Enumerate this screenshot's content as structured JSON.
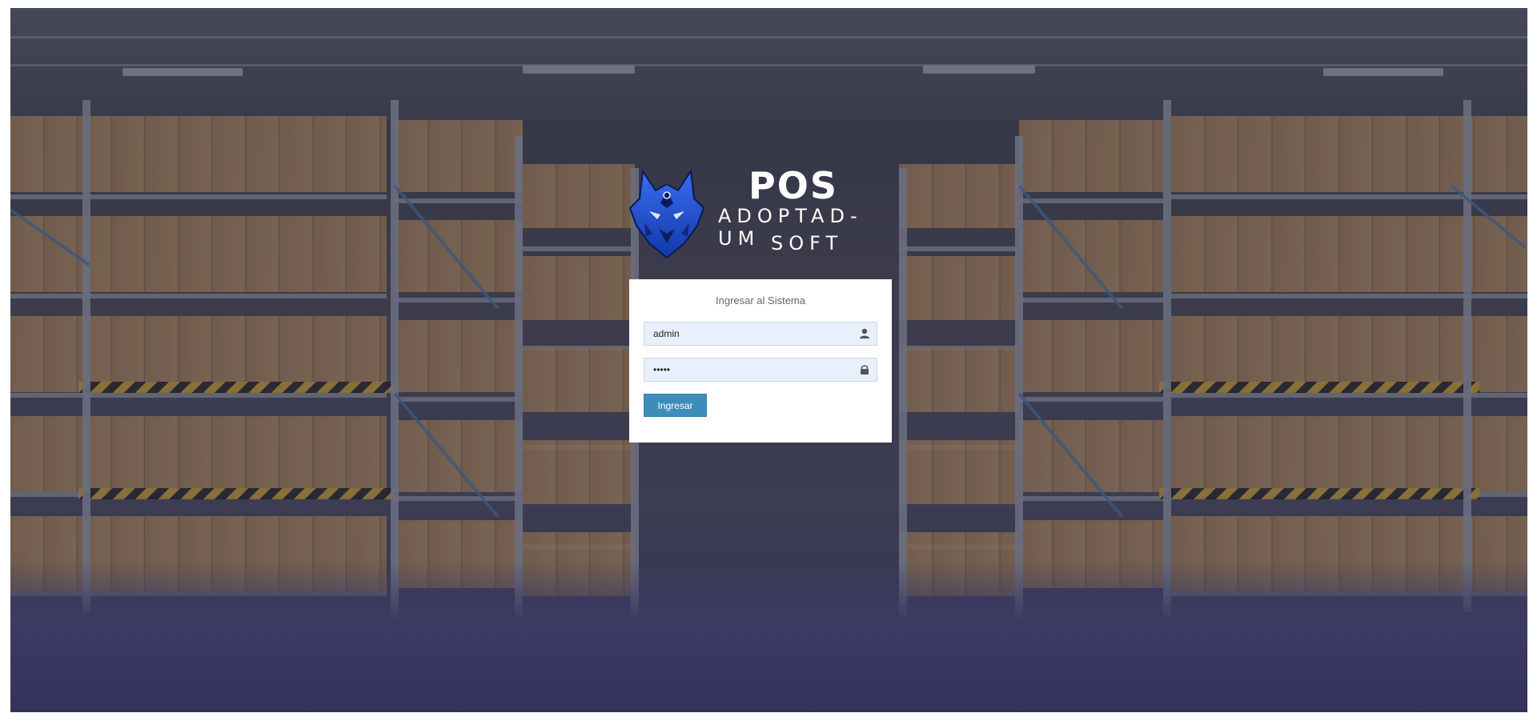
{
  "brand": {
    "title": "POS",
    "line1": "ADOPTAD-UM",
    "line2": "SOFT"
  },
  "login": {
    "heading": "Ingresar al Sistema",
    "username_value": "admin",
    "password_value": "•••••",
    "submit_label": "Ingresar"
  },
  "icons": {
    "username": "user-icon",
    "password": "lock-icon",
    "logo": "wolf-icon"
  },
  "colors": {
    "button": "#3c8dbc",
    "input_bg": "#e8f0fe",
    "wolf_blue": "#1f4fd6"
  }
}
